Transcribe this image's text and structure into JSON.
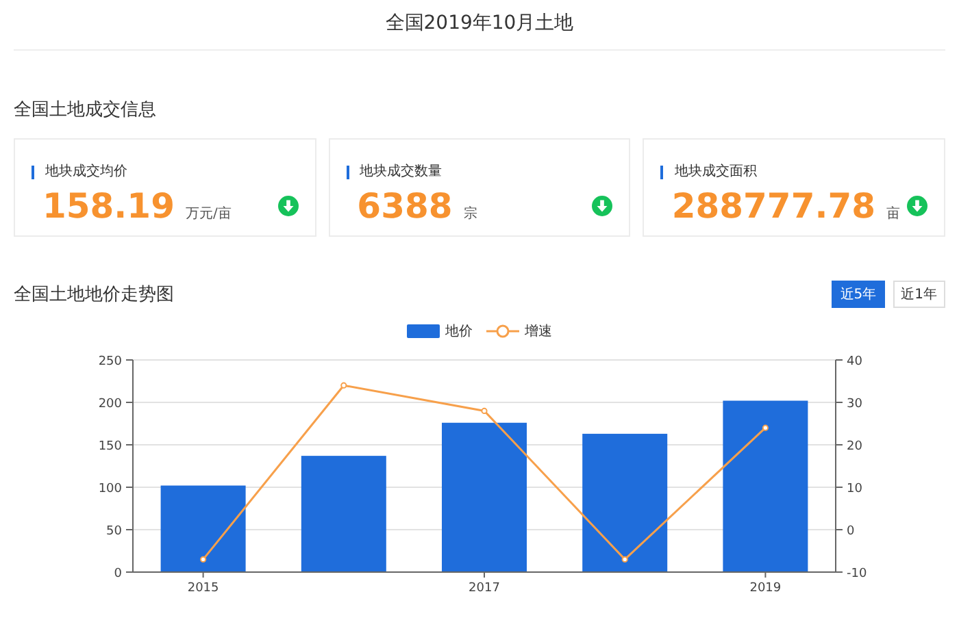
{
  "page_title": "全国2019年10月土地",
  "section_title": "全国土地成交信息",
  "cards": [
    {
      "label": "地块成交均价",
      "value": "158.19",
      "unit": "万元/亩",
      "falling": true
    },
    {
      "label": "地块成交数量",
      "value": "6388",
      "unit": "宗",
      "falling": true
    },
    {
      "label": "地块成交面积",
      "value": "288777.78",
      "unit": "亩",
      "falling": true
    }
  ],
  "chart_section": {
    "title": "全国土地地价走势图",
    "range_buttons": [
      {
        "label": "近5年",
        "selected": true
      },
      {
        "label": "近1年",
        "selected": false
      }
    ],
    "charts": [
      {
        "chart_data": {
          "type": "bar",
          "categories": [
            null,
            null,
            null,
            null,
            null
          ],
          "series": [
            {
              "name": "地价",
              "color": "#1f6ddb",
              "values": [
                102,
                137,
                176,
                163,
                202
              ]
            }
          ],
          "ylim": [
            0,
            250
          ],
          "yticks": [
            0,
            50,
            100,
            150,
            200,
            250
          ],
          "grid": true,
          "legend": "top"
        }
      },
      {
        "chart_data": {
          "type": "line",
          "x": [
            2015,
            2016,
            2017,
            2018,
            2019
          ],
          "xlim": [
            2014.5,
            2019.5
          ],
          "xticks": [
            2015,
            2017,
            2019
          ],
          "series": [
            {
              "name": "增速",
              "color": "#f7a04b",
              "marker": "circle",
              "values": [
                -7,
                34,
                28,
                -7,
                24
              ]
            }
          ],
          "ylim": [
            -10,
            40
          ],
          "yticks": [
            -10,
            0,
            10,
            20,
            30,
            40
          ]
        }
      }
    ]
  }
}
